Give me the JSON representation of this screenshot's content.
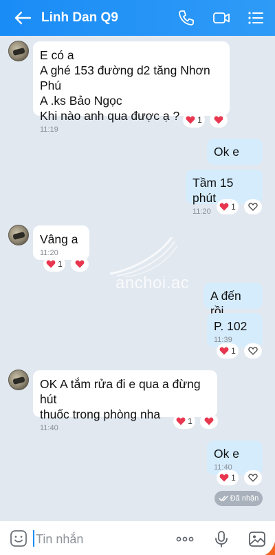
{
  "header": {
    "title": "Linh Dan Q9",
    "back_icon": "back-arrow-icon",
    "call_icon": "phone-icon",
    "video_icon": "video-icon",
    "menu_icon": "menu-icon",
    "background": "#1a8cf6"
  },
  "messages": [
    {
      "sender": "contact",
      "text": "E có a\nA ghé 153 đường d2 tăng Nhơn Phú\nA .ks Bảo Ngọc\nKhi nào anh qua được ạ ?",
      "time": "11:19",
      "reaction_count": "1"
    },
    {
      "sender": "me",
      "text": "Ok e",
      "time": ""
    },
    {
      "sender": "me",
      "text": "Tầm 15 phút",
      "time": "11:20",
      "reaction_count": "1"
    },
    {
      "sender": "contact",
      "text": "Vâng a",
      "time": "11:20",
      "reaction_count": "1"
    },
    {
      "sender": "me",
      "text": "A đến rồi",
      "time": ""
    },
    {
      "sender": "me",
      "text": "P. 102",
      "time": "11:39",
      "reaction_count": "1"
    },
    {
      "sender": "contact",
      "text": "OK A tắm rửa đi e qua a đừng hút\nthuốc trong phòng nha",
      "time": "11:40",
      "reaction_count": "1"
    },
    {
      "sender": "me",
      "text": "Ok e",
      "time": "11:40",
      "reaction_count": "1"
    }
  ],
  "status": {
    "seen_label": "Đã nhận"
  },
  "watermark": {
    "text": "anchoi.ac"
  },
  "composer": {
    "placeholder": "Tin nhắn",
    "emoji_icon": "emoji-icon",
    "more_icon": "more-dots-icon",
    "mic_icon": "microphone-icon",
    "image_icon": "image-icon"
  },
  "colors": {
    "incoming_bubble": "#ffffff",
    "outgoing_bubble": "#d5ecfd",
    "chat_background": "#e2e8f0",
    "heart": "#e8364f"
  }
}
